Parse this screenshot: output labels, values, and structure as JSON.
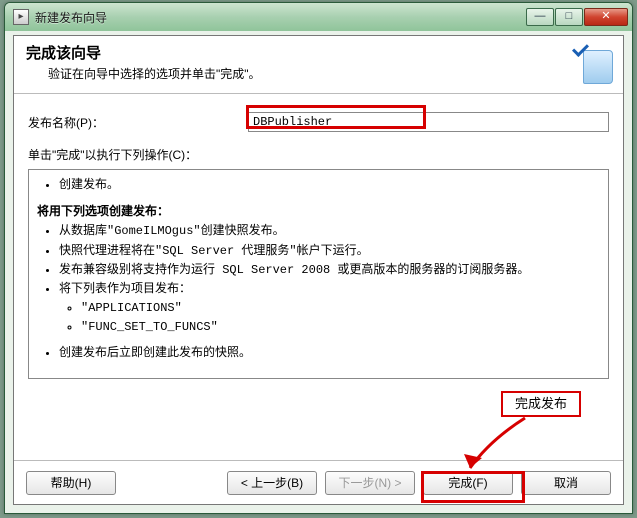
{
  "window": {
    "title": "新建发布向导",
    "icon_glyph": "▸",
    "controls": {
      "min": "—",
      "max": "□",
      "close": "✕"
    }
  },
  "header": {
    "title": "完成该向导",
    "subtitle": "验证在向导中选择的选项并单击\"完成\"。"
  },
  "form": {
    "name_label": "发布名称(P)：",
    "name_value": "DBPublisher",
    "ops_label": "单击\"完成\"以执行下列操作(C)："
  },
  "summary": {
    "line1": "创建发布。",
    "heading": "将用下列选项创建发布：",
    "items": [
      "从数据库\"GomeILMOgus\"创建快照发布。",
      "快照代理进程将在\"SQL Server 代理服务\"帐户下运行。",
      "发布兼容级别将支持作为运行 SQL Server 2008 或更高版本的服务器的订阅服务器。",
      "将下列表作为项目发布：",
      "创建发布后立即创建此发布的快照。"
    ],
    "subitems": [
      "\"APPLICATIONS\"",
      "\"FUNC_SET_TO_FUNCS\""
    ]
  },
  "footer": {
    "help": "帮助(H)",
    "back": "< 上一步(B)",
    "next": "下一步(N) >",
    "finish": "完成(F)",
    "cancel": "取消"
  },
  "annotations": {
    "callout": "完成发布"
  }
}
